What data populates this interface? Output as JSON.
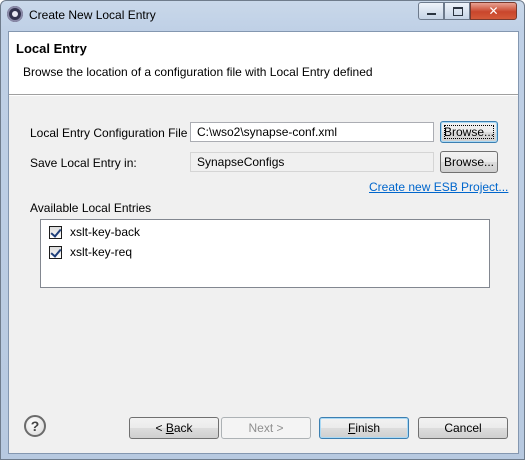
{
  "window": {
    "title": "Create New Local Entry"
  },
  "header": {
    "title": "Local Entry",
    "description": "Browse the location of a configuration file with Local Entry defined"
  },
  "form": {
    "config_file_label": "Local Entry Configuration File",
    "config_file_value": "C:\\wso2\\synapse-conf.xml",
    "browse_label": "Browse...",
    "save_in_label": "Save Local Entry in:",
    "save_in_value": "SynapseConfigs",
    "create_project_link": "Create new ESB Project..."
  },
  "entries": {
    "label": "Available Local Entries",
    "items": [
      {
        "label": "xslt-key-back",
        "checked": true
      },
      {
        "label": "xslt-key-req",
        "checked": true
      }
    ]
  },
  "footer": {
    "back": {
      "prefix": "< ",
      "mnemonic": "B",
      "rest": "ack"
    },
    "next_label": "Next >",
    "finish": {
      "mnemonic": "F",
      "rest": "inish"
    },
    "cancel_label": "Cancel"
  },
  "icons": {
    "app": "eclipse-icon",
    "help": "help-icon",
    "checkbox": "checkmark-icon"
  }
}
